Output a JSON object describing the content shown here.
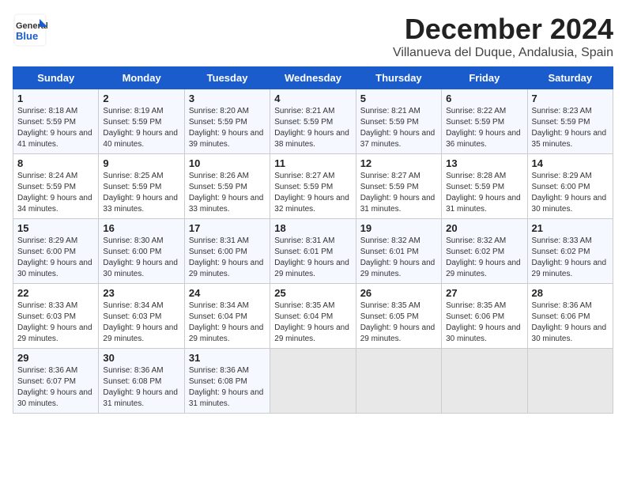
{
  "header": {
    "logo_general": "General",
    "logo_blue": "Blue",
    "month_title": "December 2024",
    "subtitle": "Villanueva del Duque, Andalusia, Spain"
  },
  "days_of_week": [
    "Sunday",
    "Monday",
    "Tuesday",
    "Wednesday",
    "Thursday",
    "Friday",
    "Saturday"
  ],
  "weeks": [
    [
      {
        "day": "1",
        "text": "Sunrise: 8:18 AM\nSunset: 5:59 PM\nDaylight: 9 hours and 41 minutes."
      },
      {
        "day": "2",
        "text": "Sunrise: 8:19 AM\nSunset: 5:59 PM\nDaylight: 9 hours and 40 minutes."
      },
      {
        "day": "3",
        "text": "Sunrise: 8:20 AM\nSunset: 5:59 PM\nDaylight: 9 hours and 39 minutes."
      },
      {
        "day": "4",
        "text": "Sunrise: 8:21 AM\nSunset: 5:59 PM\nDaylight: 9 hours and 38 minutes."
      },
      {
        "day": "5",
        "text": "Sunrise: 8:21 AM\nSunset: 5:59 PM\nDaylight: 9 hours and 37 minutes."
      },
      {
        "day": "6",
        "text": "Sunrise: 8:22 AM\nSunset: 5:59 PM\nDaylight: 9 hours and 36 minutes."
      },
      {
        "day": "7",
        "text": "Sunrise: 8:23 AM\nSunset: 5:59 PM\nDaylight: 9 hours and 35 minutes."
      }
    ],
    [
      {
        "day": "8",
        "text": "Sunrise: 8:24 AM\nSunset: 5:59 PM\nDaylight: 9 hours and 34 minutes."
      },
      {
        "day": "9",
        "text": "Sunrise: 8:25 AM\nSunset: 5:59 PM\nDaylight: 9 hours and 33 minutes."
      },
      {
        "day": "10",
        "text": "Sunrise: 8:26 AM\nSunset: 5:59 PM\nDaylight: 9 hours and 33 minutes."
      },
      {
        "day": "11",
        "text": "Sunrise: 8:27 AM\nSunset: 5:59 PM\nDaylight: 9 hours and 32 minutes."
      },
      {
        "day": "12",
        "text": "Sunrise: 8:27 AM\nSunset: 5:59 PM\nDaylight: 9 hours and 31 minutes."
      },
      {
        "day": "13",
        "text": "Sunrise: 8:28 AM\nSunset: 5:59 PM\nDaylight: 9 hours and 31 minutes."
      },
      {
        "day": "14",
        "text": "Sunrise: 8:29 AM\nSunset: 6:00 PM\nDaylight: 9 hours and 30 minutes."
      }
    ],
    [
      {
        "day": "15",
        "text": "Sunrise: 8:29 AM\nSunset: 6:00 PM\nDaylight: 9 hours and 30 minutes."
      },
      {
        "day": "16",
        "text": "Sunrise: 8:30 AM\nSunset: 6:00 PM\nDaylight: 9 hours and 30 minutes."
      },
      {
        "day": "17",
        "text": "Sunrise: 8:31 AM\nSunset: 6:00 PM\nDaylight: 9 hours and 29 minutes."
      },
      {
        "day": "18",
        "text": "Sunrise: 8:31 AM\nSunset: 6:01 PM\nDaylight: 9 hours and 29 minutes."
      },
      {
        "day": "19",
        "text": "Sunrise: 8:32 AM\nSunset: 6:01 PM\nDaylight: 9 hours and 29 minutes."
      },
      {
        "day": "20",
        "text": "Sunrise: 8:32 AM\nSunset: 6:02 PM\nDaylight: 9 hours and 29 minutes."
      },
      {
        "day": "21",
        "text": "Sunrise: 8:33 AM\nSunset: 6:02 PM\nDaylight: 9 hours and 29 minutes."
      }
    ],
    [
      {
        "day": "22",
        "text": "Sunrise: 8:33 AM\nSunset: 6:03 PM\nDaylight: 9 hours and 29 minutes."
      },
      {
        "day": "23",
        "text": "Sunrise: 8:34 AM\nSunset: 6:03 PM\nDaylight: 9 hours and 29 minutes."
      },
      {
        "day": "24",
        "text": "Sunrise: 8:34 AM\nSunset: 6:04 PM\nDaylight: 9 hours and 29 minutes."
      },
      {
        "day": "25",
        "text": "Sunrise: 8:35 AM\nSunset: 6:04 PM\nDaylight: 9 hours and 29 minutes."
      },
      {
        "day": "26",
        "text": "Sunrise: 8:35 AM\nSunset: 6:05 PM\nDaylight: 9 hours and 29 minutes."
      },
      {
        "day": "27",
        "text": "Sunrise: 8:35 AM\nSunset: 6:06 PM\nDaylight: 9 hours and 30 minutes."
      },
      {
        "day": "28",
        "text": "Sunrise: 8:36 AM\nSunset: 6:06 PM\nDaylight: 9 hours and 30 minutes."
      }
    ],
    [
      {
        "day": "29",
        "text": "Sunrise: 8:36 AM\nSunset: 6:07 PM\nDaylight: 9 hours and 30 minutes."
      },
      {
        "day": "30",
        "text": "Sunrise: 8:36 AM\nSunset: 6:08 PM\nDaylight: 9 hours and 31 minutes."
      },
      {
        "day": "31",
        "text": "Sunrise: 8:36 AM\nSunset: 6:08 PM\nDaylight: 9 hours and 31 minutes."
      },
      {
        "day": "",
        "text": ""
      },
      {
        "day": "",
        "text": ""
      },
      {
        "day": "",
        "text": ""
      },
      {
        "day": "",
        "text": ""
      }
    ]
  ]
}
